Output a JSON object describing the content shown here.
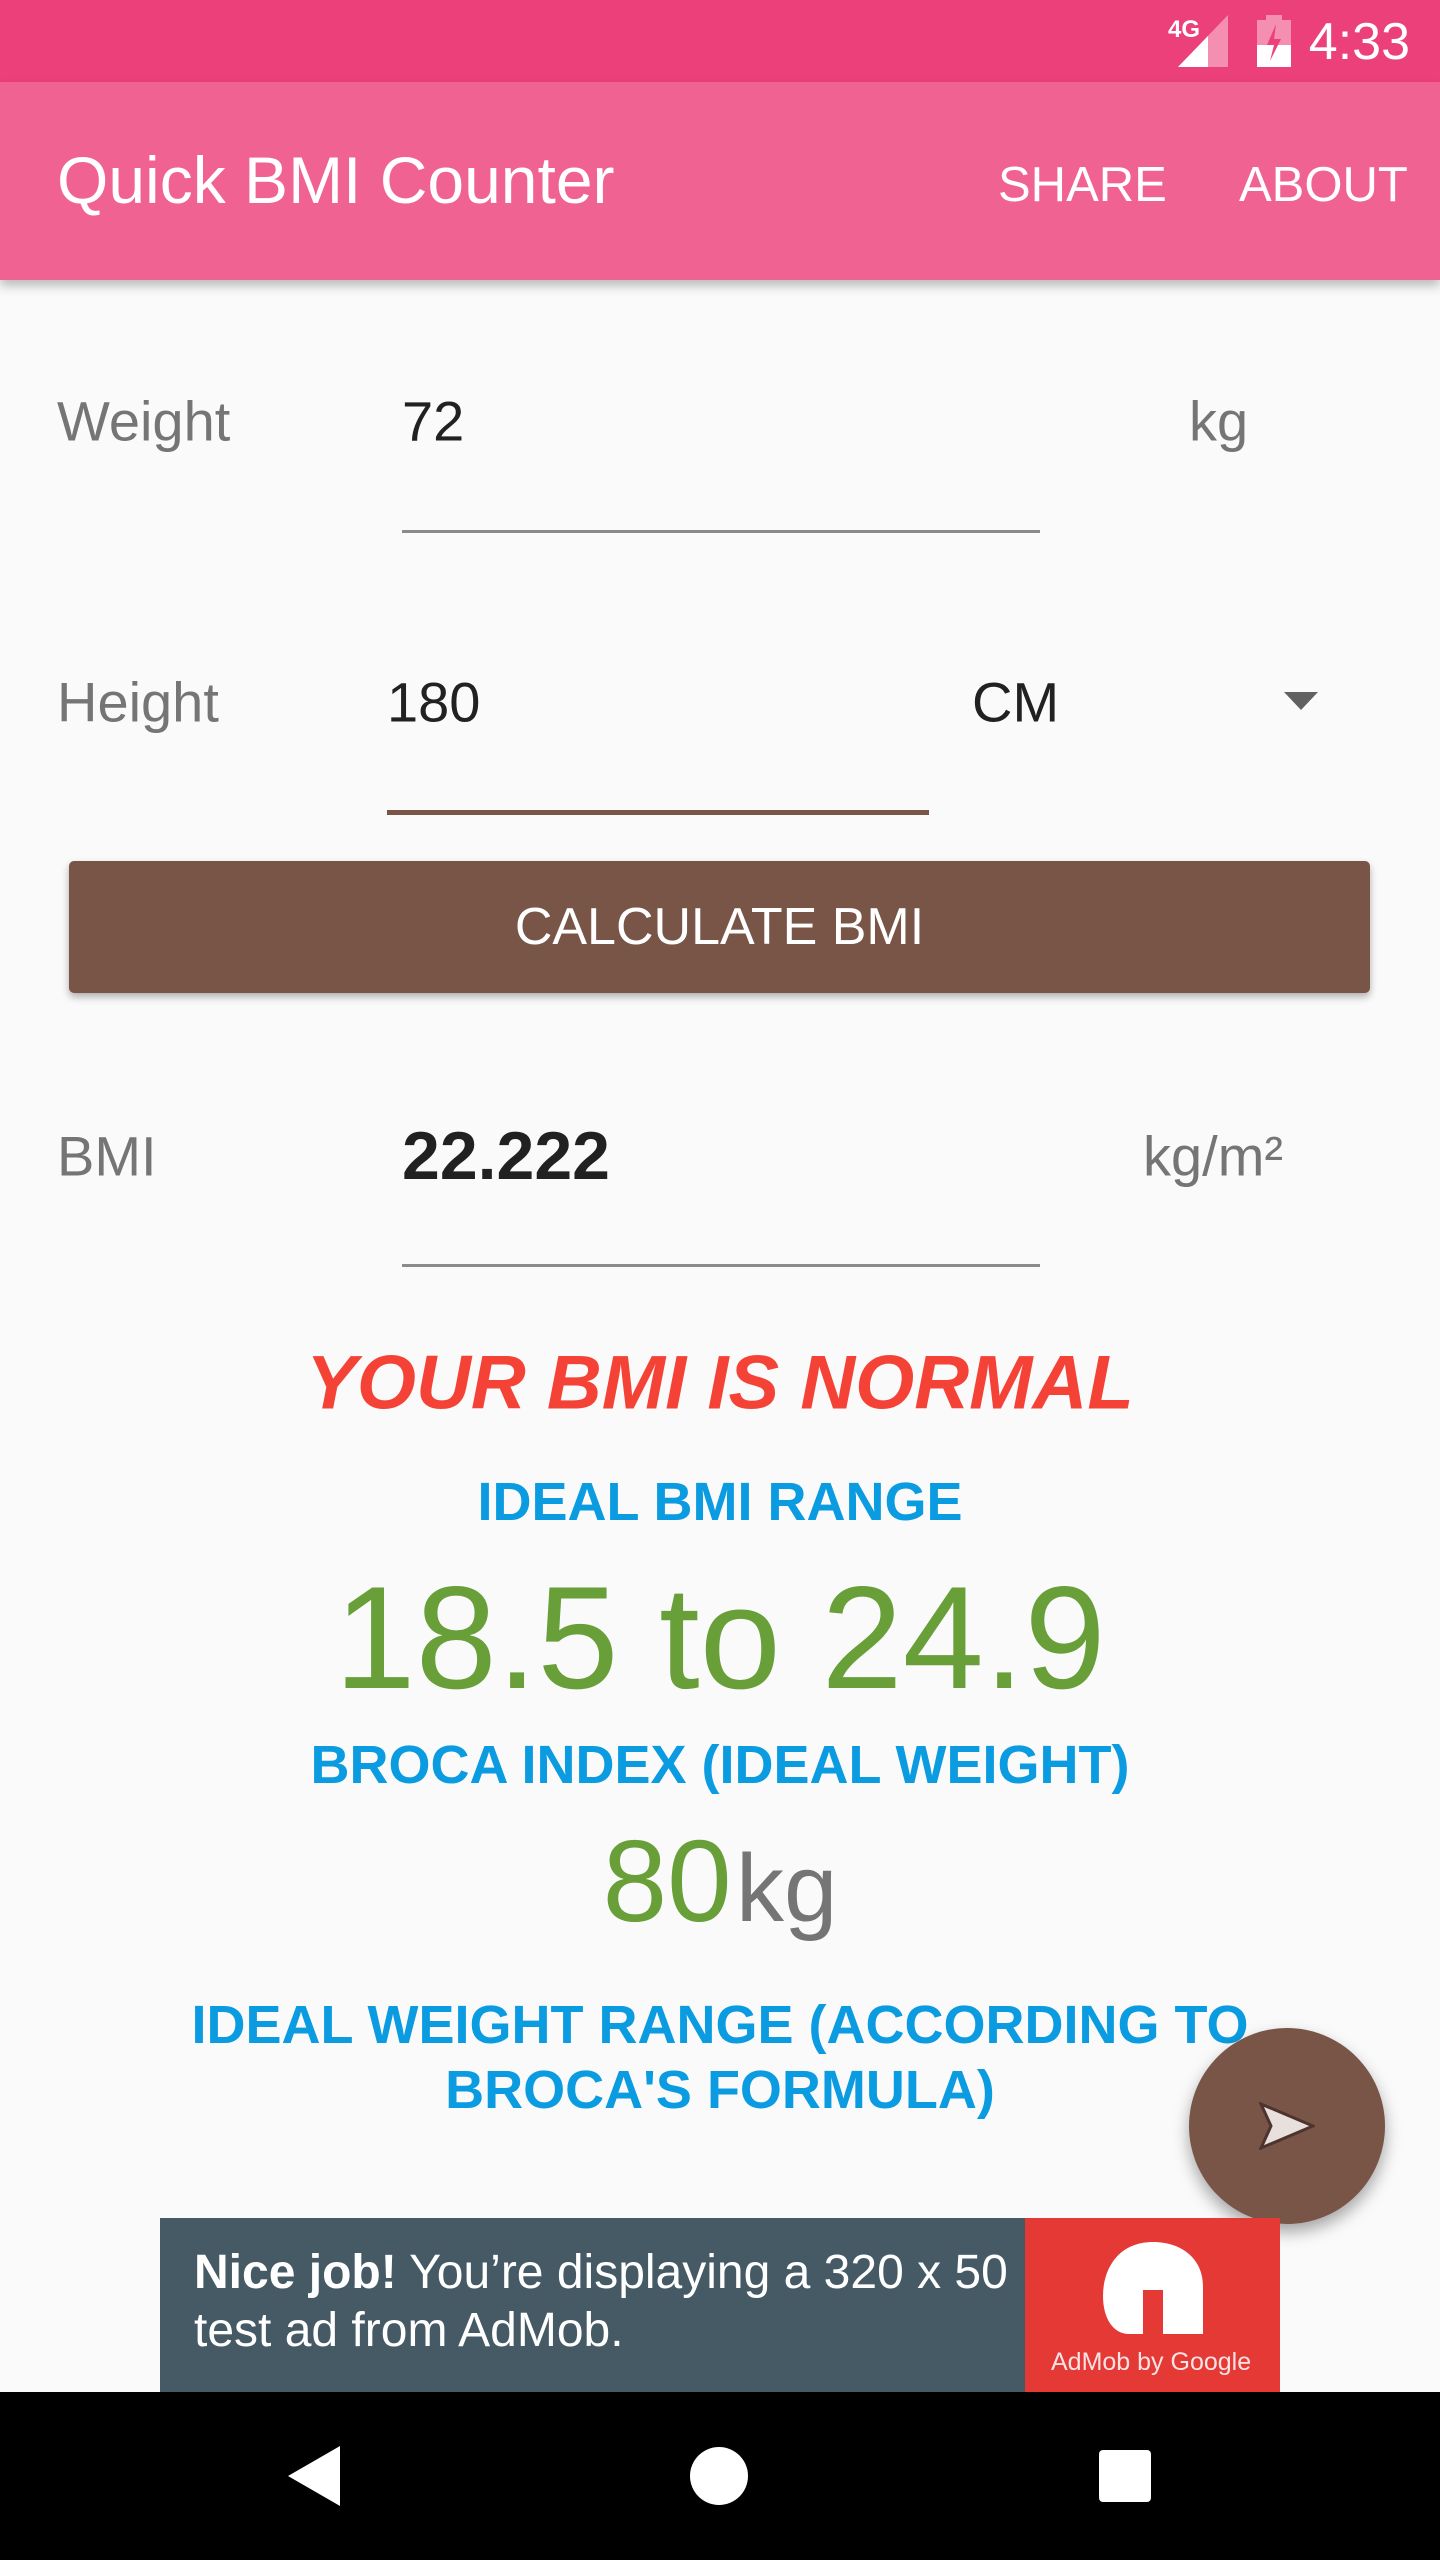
{
  "status_bar": {
    "network": "4G",
    "time": "4:33"
  },
  "toolbar": {
    "title": "Quick BMI Counter",
    "share": "SHARE",
    "about": "ABOUT"
  },
  "form": {
    "weight_label": "Weight",
    "weight_value": "72",
    "weight_unit": "kg",
    "height_label": "Height",
    "height_value": "180",
    "height_unit": "CM",
    "calculate": "CALCULATE BMI",
    "bmi_label": "BMI",
    "bmi_value": "22.222",
    "bmi_unit": "kg/m²"
  },
  "results": {
    "status": "YOUR BMI IS NORMAL",
    "ideal_bmi_heading": "IDEAL BMI RANGE",
    "ideal_bmi_range": "18.5 to 24.9",
    "broca_heading": "BROCA INDEX (IDEAL WEIGHT)",
    "broca_value": "80",
    "broca_unit": "kg",
    "ideal_weight_heading_1": "IDEAL WEIGHT RANGE (ACCORDING TO",
    "ideal_weight_heading_2": "BROCA'S FORMULA)"
  },
  "ad": {
    "bold": "Nice job!",
    "text1": " You’re displaying a 320 x 50",
    "text2": "test ad from AdMob.",
    "brand": "AdMob by Google"
  },
  "colors": {
    "primary": "#F06292",
    "status": "#EC407A",
    "accent": "#795548",
    "normal": "#F44336",
    "heading": "#0A9BE0",
    "value": "#689F38"
  }
}
